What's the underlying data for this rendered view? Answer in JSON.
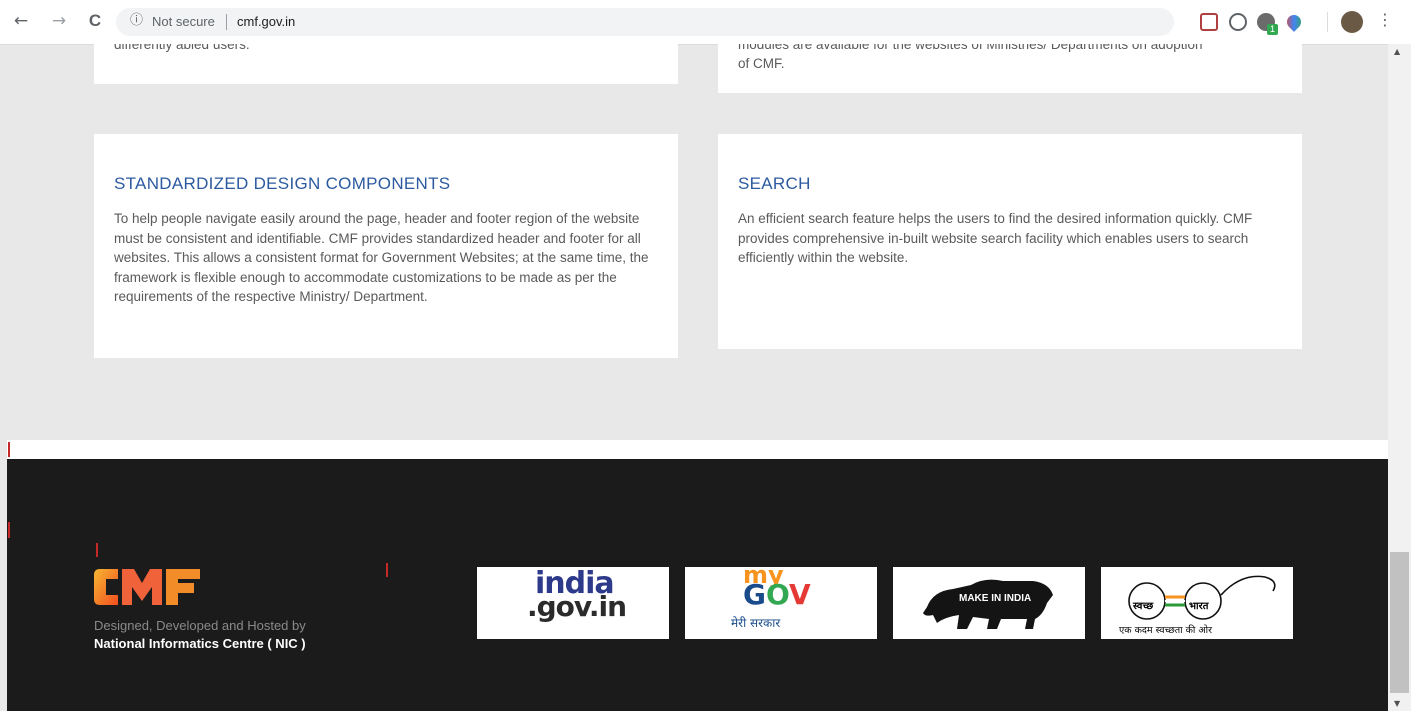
{
  "browser": {
    "back_icon": "←",
    "forward_icon": "→",
    "reload_icon": "C",
    "info_icon": "ⓘ",
    "security_label": "Not secure",
    "url": "cmf.gov.in",
    "bookmark_icon": "☆",
    "menu_icon": "⋮",
    "extension_badge": "1"
  },
  "cards": {
    "top_left_partial": "differently abled users.",
    "top_right_partial": "modules are available for the websites of Ministries/ Departments on adoption",
    "top_right_tail": "of CMF.",
    "design": {
      "title": "STANDARDIZED DESIGN COMPONENTS",
      "body": "To help people navigate easily around the page, header and footer region of the website must be consistent and identifiable. CMF provides standardized header and footer for all websites. This allows a consistent format for Government Websites; at the same time, the framework is flexible enough to accommodate customizations to be made as per the requirements of the respective Ministry/ Department."
    },
    "search": {
      "title": "SEARCH",
      "body": "An efficient search feature helps the users to find the desired information quickly. CMF provides comprehensive in-built website search facility which enables users to search efficiently within the website."
    }
  },
  "footer": {
    "logo_text": "CMF",
    "credit_line1": "Designed, Developed and Hosted by",
    "credit_line2": "National Informatics Centre ( NIC )",
    "partners": {
      "indiagov_top": "india",
      "indiagov_bottom": ".gov.in",
      "mygov_my": "my",
      "mygov_gov_g": "G",
      "mygov_gov_o": "O",
      "mygov_gov_v": "V",
      "mygov_sub": "मेरी सरकार",
      "makeinindia": "MAKE IN INDIA",
      "swachh_left": "स्वच्छ",
      "swachh_right": "भारत",
      "swachh_caption": "एक कदम स्वच्छता की ओर"
    }
  },
  "colors": {
    "title_blue": "#2c5aa0",
    "footer_bg": "#1b1b1b",
    "page_bg": "#e8e8e8",
    "accent_red": "#c62828"
  }
}
